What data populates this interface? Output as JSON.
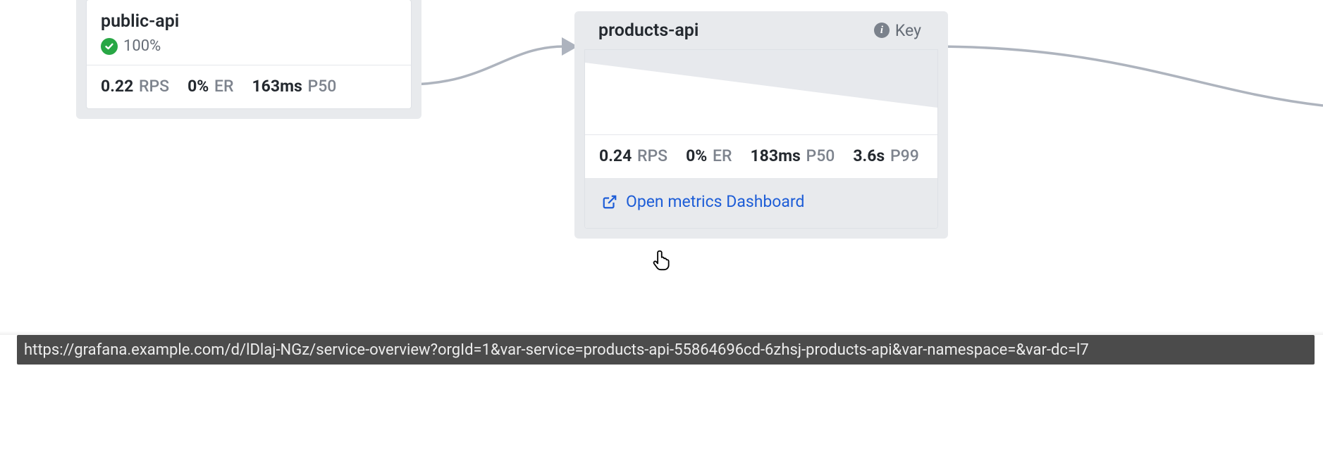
{
  "nodes": {
    "public_api": {
      "title": "public-api",
      "health": "100%",
      "metrics": {
        "rps_val": "0.22",
        "rps_lbl": "RPS",
        "er_val": "0%",
        "er_lbl": "ER",
        "p50_val": "163ms",
        "p50_lbl": "P50"
      }
    },
    "products_api": {
      "title": "products-api",
      "key_label": "Key",
      "metrics": {
        "rps_val": "0.24",
        "rps_lbl": "RPS",
        "er_val": "0%",
        "er_lbl": "ER",
        "p50_val": "183ms",
        "p50_lbl": "P50",
        "p99_val": "3.6s",
        "p99_lbl": "P99"
      },
      "link_label": "Open metrics Dashboard"
    }
  },
  "status_bar_url": "https://grafana.example.com/d/lDlaj-NGz/service-overview?orgId=1&var-service=products-api-55864696cd-6zhsj-products-api&var-namespace=&var-dc=l7",
  "colors": {
    "link": "#1D5DD7",
    "success": "#28A745",
    "node_bg": "#E8EAED",
    "edge": "#AEB4BE"
  }
}
